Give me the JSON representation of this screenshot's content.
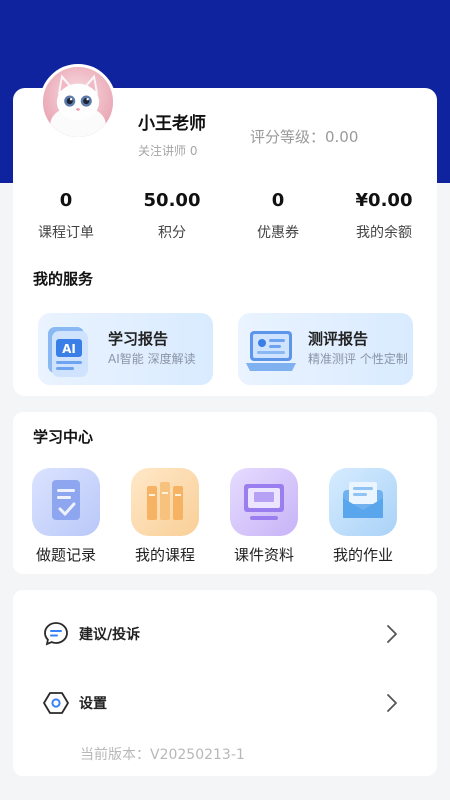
{
  "profile": {
    "name": "小王老师",
    "follow": "关注讲师 0",
    "grade": "评分等级：0.00"
  },
  "stats": [
    {
      "value": "0",
      "label": "课程订单"
    },
    {
      "value": "50.00",
      "label": "积分"
    },
    {
      "value": "0",
      "label": "优惠券"
    },
    {
      "value": "¥0.00",
      "label": "我的余额"
    }
  ],
  "services": {
    "title": "我的服务",
    "items": [
      {
        "title": "学习报告",
        "subtitle": "AI智能 深度解读",
        "icon": "ai-report-icon"
      },
      {
        "title": "测评报告",
        "subtitle": "精准测评 个性定制",
        "icon": "assessment-laptop-icon"
      }
    ]
  },
  "learning": {
    "title": "学习中心",
    "items": [
      {
        "label": "做题记录",
        "icon": "exercise-record-icon"
      },
      {
        "label": "我的课程",
        "icon": "courses-books-icon"
      },
      {
        "label": "课件资料",
        "icon": "courseware-monitor-icon"
      },
      {
        "label": "我的作业",
        "icon": "homework-mail-icon"
      }
    ]
  },
  "menu": {
    "items": [
      {
        "label": "建议/投诉",
        "icon": "feedback-chat-icon"
      },
      {
        "label": "设置",
        "icon": "settings-hexagon-icon"
      }
    ],
    "version": "当前版本：V20250213-1"
  },
  "colors": {
    "header": "#10239e",
    "service_bg": "#e3efff",
    "accent_blue": "#3b82f6"
  }
}
